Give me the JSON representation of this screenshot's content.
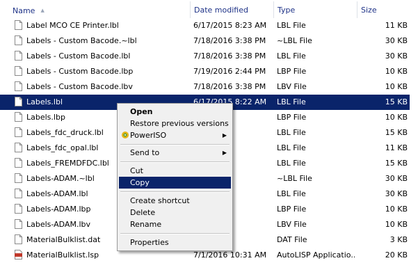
{
  "columns": {
    "name": "Name",
    "date": "Date modified",
    "type": "Type",
    "size": "Size"
  },
  "rows": [
    {
      "name": "Label MCO CE Printer.lbl",
      "date": "6/17/2015 8:23 AM",
      "type": "LBL File",
      "size": "11 KB"
    },
    {
      "name": "Labels - Custom Bacode.~lbl",
      "date": "7/18/2016 3:38 PM",
      "type": "~LBL File",
      "size": "30 KB"
    },
    {
      "name": "Labels - Custom Bacode.lbl",
      "date": "7/18/2016 3:38 PM",
      "type": "LBL File",
      "size": "30 KB"
    },
    {
      "name": "Labels - Custom Bacode.lbp",
      "date": "7/19/2016 2:44 PM",
      "type": "LBP File",
      "size": "10 KB"
    },
    {
      "name": "Labels - Custom Bacode.lbv",
      "date": "7/18/2016 3:38 PM",
      "type": "LBV File",
      "size": "10 KB"
    },
    {
      "name": "Labels.lbl",
      "date": "6/17/2015 8:22 AM",
      "type": "LBL File",
      "size": "15 KB"
    },
    {
      "name": "Labels.lbp",
      "date": ":00 PM",
      "type": "LBP File",
      "size": "10 KB"
    },
    {
      "name": "Labels_fdc_druck.lbl",
      "date": ":23 AM",
      "type": "LBL File",
      "size": "15 KB"
    },
    {
      "name": "Labels_fdc_opal.lbl",
      "date": ":23 AM",
      "type": "LBL File",
      "size": "11 KB"
    },
    {
      "name": "Labels_FREMDFDC.lbl",
      "date": ":36 AM",
      "type": "LBL File",
      "size": "15 KB"
    },
    {
      "name": "Labels-ADAM.~lbl",
      "date": ":17 PM",
      "type": "~LBL File",
      "size": "30 KB"
    },
    {
      "name": "Labels-ADAM.lbl",
      "date": ":17 PM",
      "type": "LBL File",
      "size": "30 KB"
    },
    {
      "name": "Labels-ADAM.lbp",
      "date": ":35 PM",
      "type": "LBP File",
      "size": "10 KB"
    },
    {
      "name": "Labels-ADAM.lbv",
      "date": ":17 PM",
      "type": "LBV File",
      "size": "10 KB"
    },
    {
      "name": "MaterialBulklist.dat",
      "date": ":01 PM",
      "type": "DAT File",
      "size": "3 KB"
    },
    {
      "name": "MaterialBulklist.lsp",
      "date": "7/1/2016 10:31 AM",
      "type": "AutoLISP Applicatio...",
      "size": "20 KB"
    }
  ],
  "context_menu": {
    "open": "Open",
    "restore": "Restore previous versions",
    "poweriso": "PowerISO",
    "send_to": "Send to",
    "cut": "Cut",
    "copy": "Copy",
    "create_shortcut": "Create shortcut",
    "delete": "Delete",
    "rename": "Rename",
    "properties": "Properties"
  },
  "colors": {
    "selection": "#0a246a",
    "header_text": "#1e3287",
    "menu_bg": "#f0f0f0",
    "lisp_icon": "#c0392b"
  }
}
